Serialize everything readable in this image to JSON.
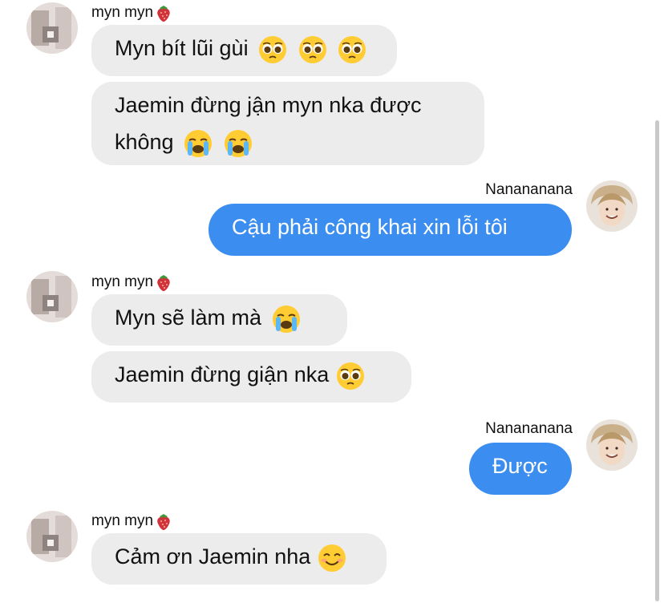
{
  "messages": [
    {
      "sender": "myn myn",
      "text": "Myn bít lũi gùi",
      "emojis": [
        "pleading-face",
        "pleading-face",
        "pleading-face"
      ]
    },
    {
      "sender": "myn myn",
      "text": "Jaemin đừng jận myn nka được\nkhông",
      "emojis": [
        "crying-face",
        "crying-face"
      ]
    },
    {
      "sender": "Nanananana",
      "text": "Cậu phải công khai xin lỗi tôi",
      "emojis": []
    },
    {
      "sender": "myn myn",
      "text": "Myn sẽ làm mà",
      "emojis": [
        "crying-face"
      ]
    },
    {
      "sender": "myn myn",
      "text": "Jaemin đừng giận nka",
      "emojis": [
        "pleading-face"
      ]
    },
    {
      "sender": "Nanananana",
      "text": "Được",
      "emojis": []
    },
    {
      "sender": "myn myn",
      "text": "Cảm ơn Jaemin nha",
      "emojis": [
        "smiling-face"
      ]
    }
  ],
  "sender_labels": {
    "incoming": "myn myn",
    "outgoing": "Nanananana"
  },
  "sender_emoji": "strawberry",
  "colors": {
    "incoming_bubble": "#ececed",
    "outgoing_bubble": "#3b8ef0",
    "background": "#ffffff"
  }
}
